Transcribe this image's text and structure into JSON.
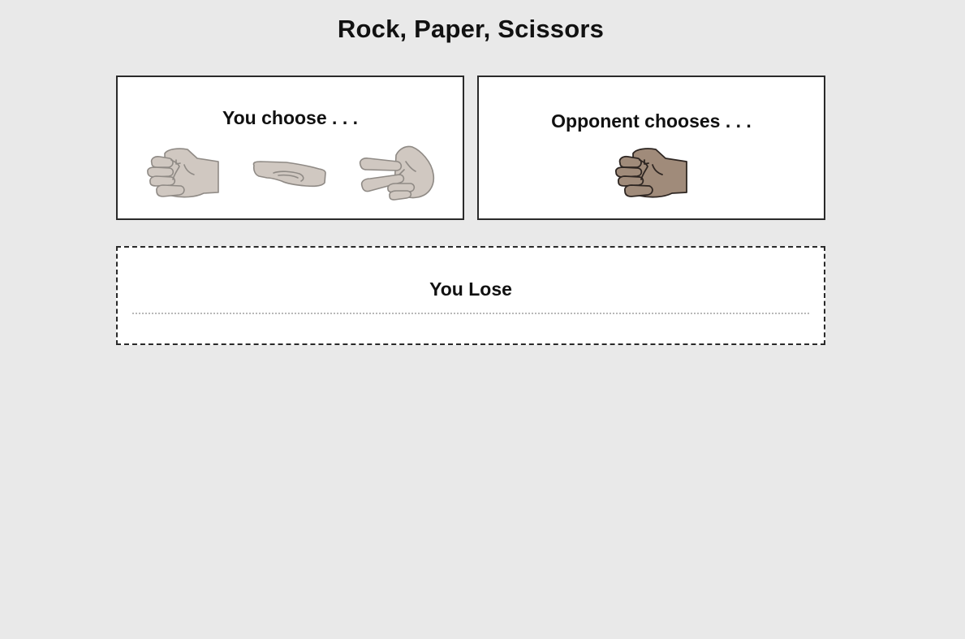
{
  "title": "Rock, Paper, Scissors",
  "player_panel": {
    "heading": "You choose . . .",
    "choices": [
      {
        "icon": "rock-hand-icon"
      },
      {
        "icon": "paper-hand-icon"
      },
      {
        "icon": "scissors-hand-icon"
      }
    ]
  },
  "opponent_panel": {
    "heading": "Opponent chooses . . .",
    "choice_icon": "rock-hand-icon"
  },
  "result": {
    "text": "You Lose"
  },
  "colors": {
    "background": "#e9e9e9",
    "player_hand_fill": "#d0c8c1",
    "player_hand_stroke": "#8f8a85",
    "opponent_hand_fill": "#a08b7a",
    "opponent_hand_stroke": "#2e2622"
  }
}
